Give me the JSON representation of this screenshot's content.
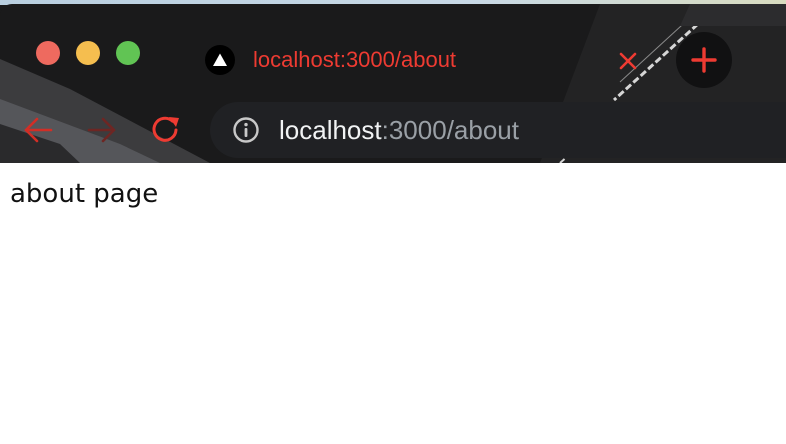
{
  "browser": {
    "tab": {
      "title": "localhost:3000/about"
    },
    "address_bar": {
      "host": "localhost",
      "path": ":3000/about"
    }
  },
  "page": {
    "text": "about page"
  },
  "colors": {
    "accent": "#ee3b32",
    "chrome_background": "#1a1a1b",
    "omnibox_background": "#202124"
  }
}
